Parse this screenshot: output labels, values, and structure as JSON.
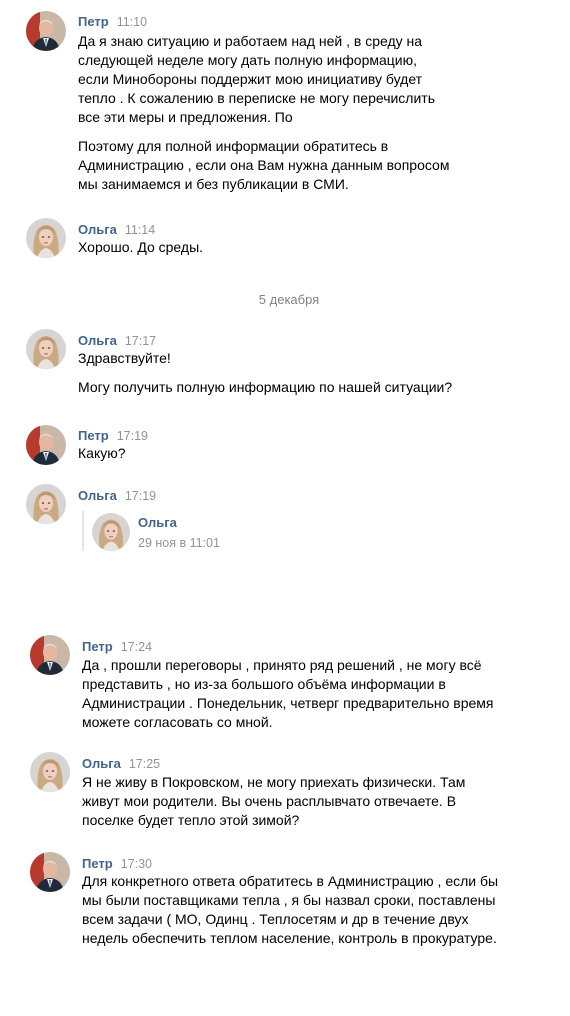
{
  "messages": [
    {
      "author": "Петр",
      "time": "11:10",
      "paragraphs": [
        "Да я знаю ситуацию и работаем над ней , в среду на следующей неделе могу дать полную информацию, если Минобороны поддержит мою инициативу будет тепло . К сожалению в переписке не могу перечислить все эти меры и предложения. По",
        "Поэтому для полной информации обратитесь в Администрацию , если она Вам нужна данным вопросом мы занимаемся и без публикации в СМИ."
      ]
    },
    {
      "author": "Ольга",
      "time": "11:14",
      "paragraphs": [
        "Хорошо. До среды."
      ]
    },
    {
      "author": "Ольга",
      "time": "17:17",
      "paragraphs": [
        "Здравствуйте!",
        "Могу получить полную информацию по нашей ситуации?"
      ]
    },
    {
      "author": "Петр",
      "time": "17:19",
      "paragraphs": [
        "Какую?"
      ]
    },
    {
      "author": "Ольга",
      "time": "17:19",
      "paragraphs": []
    },
    {
      "author": "Петр",
      "time": "17:24",
      "paragraphs": [
        "Да , прошли переговоры , принято ряд решений , не могу всё представить , но из-за большого объёма информации в Администрации . Понедельник, четверг предварительно время можете согласовать со мной."
      ]
    },
    {
      "author": "Ольга",
      "time": "17:25",
      "paragraphs": [
        "Я не живу в Покровском, не могу приехать физически. Там живут мои родители. Вы очень расплывчато отвечаете. В поселке будет тепло этой зимой?"
      ]
    },
    {
      "author": "Петр",
      "time": "17:30",
      "paragraphs": [
        "Для конкретного ответа обратитесь в Администрацию , если бы мы были поставщиками тепла , я бы назвал сроки, поставлены всем задачи ( МО, Одинц . Теплосетям и др в течение двух недель обеспечить теплом население, контроль в прокуратуре."
      ]
    }
  ],
  "date_separator": "5 декабря",
  "forwarded": {
    "author": "Ольга",
    "date": "29 ноя в 11:01"
  },
  "colors": {
    "author": "#42648b",
    "time": "#939393",
    "quote_border": "#dfe6ec"
  },
  "icons": {
    "petr_avatar": "man-in-suit-avatar",
    "olga_avatar": "woman-blonde-avatar"
  }
}
